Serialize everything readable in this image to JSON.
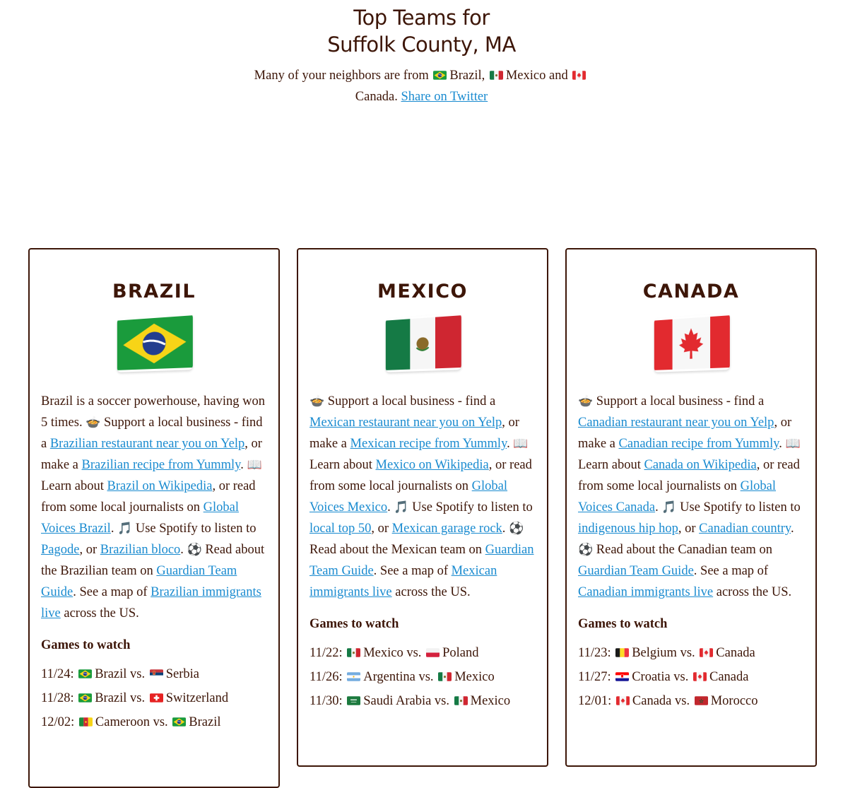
{
  "header": {
    "title_line1": "Top Teams for",
    "title_line2": "Suffolk County, MA",
    "intro": "Many of your neighbors are from",
    "country1": "Brazil",
    "country2": "Mexico",
    "and": "and",
    "country3": "Canada",
    "share_link": "Share on Twitter"
  },
  "icons": {
    "bowl": "🍲",
    "book": "📖",
    "music": "🎵",
    "ball": "⚽"
  },
  "brazil": {
    "name": "BRAZIL",
    "t1": "Brazil is a soccer powerhouse, having won 5 times.",
    "t2": "Support a local business - find a",
    "l_restaurant": "Brazilian restaurant near you on Yelp",
    "t3": ", or make a",
    "l_recipe": "Brazilian recipe from Yummly",
    "t4": ".",
    "t5": "Learn about",
    "l_wiki": "Brazil on Wikipedia",
    "t6": ", or read from some local journalists on",
    "l_gv": "Global Voices Brazil",
    "t7": ".",
    "t8": "Use Spotify to listen to",
    "l_music1": "Pagode",
    "t9": ", or",
    "l_music2": "Brazilian bloco",
    "t10": ".",
    "t11": "Read about the Brazilian team on",
    "l_guardian": "Guardian Team Guide",
    "t12": ". See a map of",
    "l_map": "Brazilian immigrants live",
    "t13": "across the US.",
    "games_heading": "Games to watch",
    "games": [
      {
        "date": "11/24:",
        "team1": "Brazil",
        "vs": "vs.",
        "team2": "Serbia"
      },
      {
        "date": "11/28:",
        "team1": "Brazil",
        "vs": "vs.",
        "team2": "Switzerland"
      },
      {
        "date": "12/02:",
        "team1": "Cameroon",
        "vs": "vs.",
        "team2": "Brazil"
      }
    ]
  },
  "mexico": {
    "name": "MEXICO",
    "t2": "Support a local business - find a",
    "l_restaurant": "Mexican restaurant near you on Yelp",
    "t3": ", or make a",
    "l_recipe": "Mexican recipe from Yummly",
    "t4": ".",
    "t5": "Learn about",
    "l_wiki": "Mexico on Wikipedia",
    "t6": ", or read from some local journalists on",
    "l_gv": "Global Voices Mexico",
    "t7": ".",
    "t8": "Use Spotify to listen to",
    "l_music1": "local top 50",
    "t9": ", or",
    "l_music2": "Mexican garage rock",
    "t10": ".",
    "t11": "Read about the Mexican team on",
    "l_guardian": "Guardian Team Guide",
    "t12": ". See a map of",
    "l_map": "Mexican immigrants live",
    "t13": "across the US.",
    "games_heading": "Games to watch",
    "games": [
      {
        "date": "11/22:",
        "team1": "Mexico",
        "vs": "vs.",
        "team2": "Poland"
      },
      {
        "date": "11/26:",
        "team1": "Argentina",
        "vs": "vs.",
        "team2": "Mexico"
      },
      {
        "date": "11/30:",
        "team1": "Saudi Arabia",
        "vs": "vs.",
        "team2": "Mexico"
      }
    ]
  },
  "canada": {
    "name": "CANADA",
    "t2": "Support a local business - find a",
    "l_restaurant": "Canadian restaurant near you on Yelp",
    "t3": ", or make a",
    "l_recipe": "Canadian recipe from Yummly",
    "t4": ".",
    "t5": "Learn about",
    "l_wiki": "Canada on Wikipedia",
    "t6": ", or read from some local journalists on",
    "l_gv": "Global Voices Canada",
    "t7": ".",
    "t8": "Use Spotify to listen to",
    "l_music1": "indigenous hip hop",
    "t9": ", or",
    "l_music2": "Canadian country",
    "t10": ".",
    "t11": "Read about the Canadian team on",
    "l_guardian": "Guardian Team Guide",
    "t12": ". See a map of",
    "l_map": "Canadian immigrants live",
    "t13": "across the US.",
    "games_heading": "Games to watch",
    "games": [
      {
        "date": "11/23:",
        "team1": "Belgium",
        "vs": "vs.",
        "team2": "Canada"
      },
      {
        "date": "11/27:",
        "team1": "Croatia",
        "vs": "vs.",
        "team2": "Canada"
      },
      {
        "date": "12/01:",
        "team1": "Canada",
        "vs": "vs.",
        "team2": "Morocco"
      }
    ]
  },
  "flag_colors": {
    "brazil_green": "#1a9b3c",
    "brazil_yellow": "#f7d417",
    "brazil_blue": "#233d8f",
    "mexico_green": "#157a45",
    "mexico_red": "#cf2631",
    "canada_red": "#e22a2f"
  }
}
